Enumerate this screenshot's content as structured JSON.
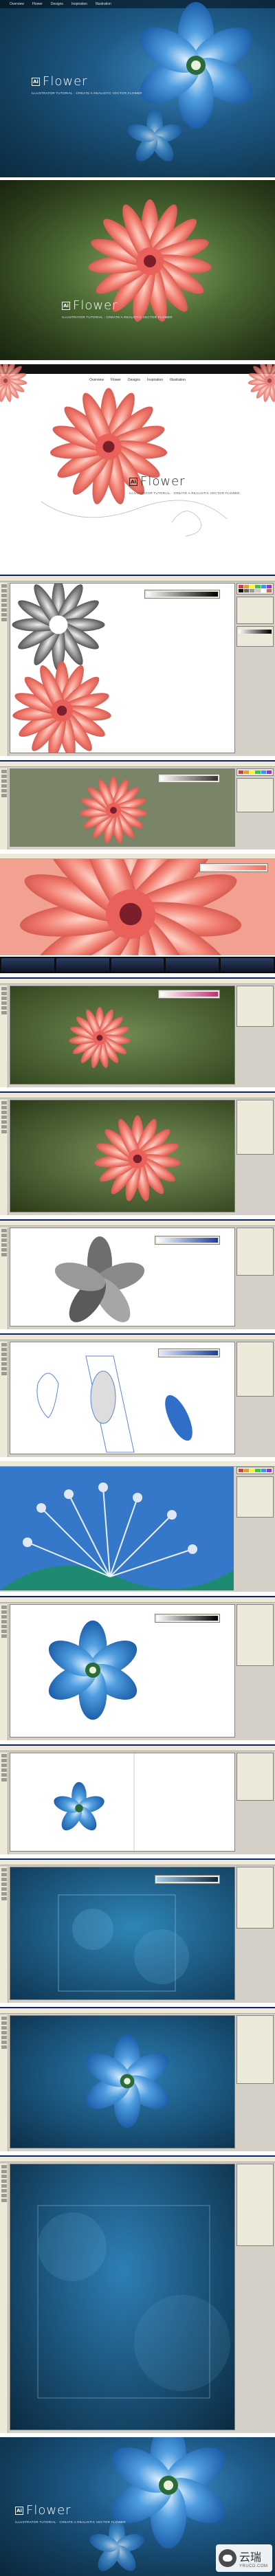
{
  "hero": {
    "nav": [
      "Overview",
      "Flower",
      "Designs",
      "Inspiration",
      "Illustration"
    ],
    "logo_mark": "Ai",
    "logo_word": "Flower",
    "tagline": "ILLUSTRATOR TUTORIAL · CREATE A REALISTIC VECTOR FLOWER"
  },
  "green": {
    "logo_mark": "Ai",
    "logo_word": "Flower",
    "tagline": "ILLUSTRATOR TUTORIAL · CREATE A REALISTIC VECTOR FLOWER"
  },
  "white": {
    "nav": [
      "Overview",
      "Flower",
      "Designs",
      "Inspiration",
      "Illustration"
    ],
    "logo_mark": "Ai",
    "logo_word": "Flower",
    "tagline": "ILLUSTRATOR TUTORIAL · CREATE A REALISTIC VECTOR FLOWER"
  },
  "final": {
    "logo_mark": "Ai",
    "logo_word": "Flower",
    "tagline": "ILLUSTRATOR TUTORIAL · CREATE A REALISTIC VECTOR FLOWER"
  },
  "watermark": {
    "cn": "云瑞",
    "en": "YRUCD.COM"
  },
  "colors": {
    "blue_petal": "#3a86d4",
    "pink_petal": "#ec6f63",
    "grey_petal": "#7f7f7f"
  }
}
